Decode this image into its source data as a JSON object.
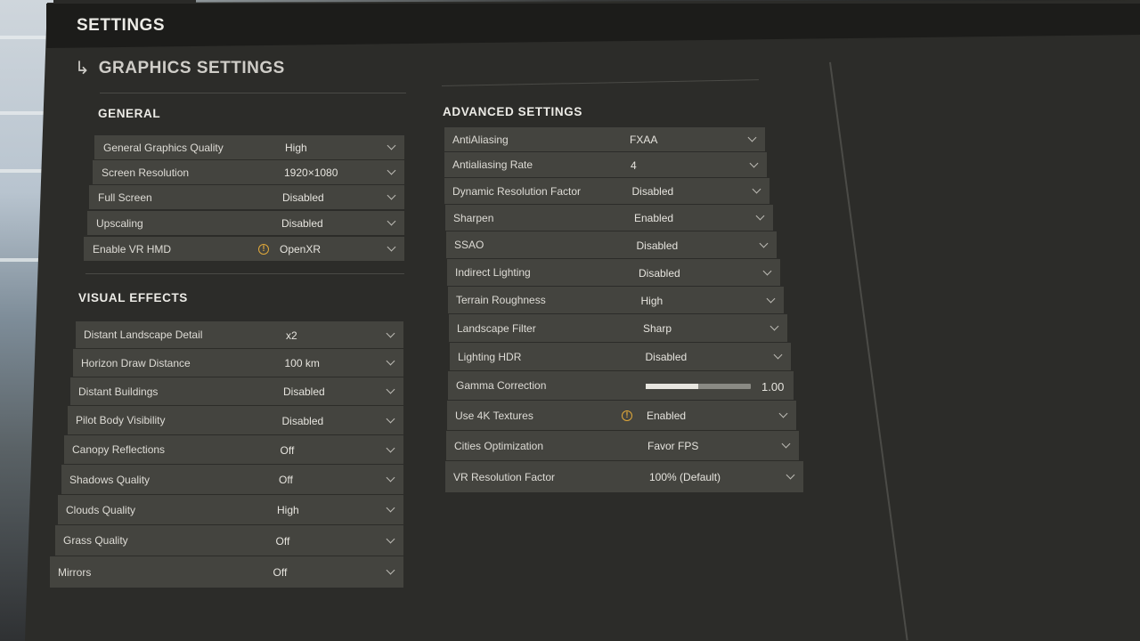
{
  "window": {
    "title": "SETTINGS"
  },
  "section": {
    "arrow": "↳",
    "title": "GRAPHICS SETTINGS"
  },
  "general": {
    "title": "GENERAL",
    "rows": [
      {
        "label": "General Graphics Quality",
        "value": "High"
      },
      {
        "label": "Screen Resolution",
        "value": "1920×1080"
      },
      {
        "label": "Full Screen",
        "value": "Disabled"
      },
      {
        "label": "Upscaling",
        "value": "Disabled"
      },
      {
        "label": "Enable VR HMD",
        "value": "OpenXR",
        "warning": true,
        "warn_glyph": "!"
      }
    ]
  },
  "visual_effects": {
    "title": "VISUAL EFFECTS",
    "rows": [
      {
        "label": "Distant Landscape Detail",
        "value": "x2"
      },
      {
        "label": "Horizon Draw Distance",
        "value": "100 km"
      },
      {
        "label": "Distant Buildings",
        "value": "Disabled"
      },
      {
        "label": "Pilot Body Visibility",
        "value": "Disabled"
      },
      {
        "label": "Canopy Reflections",
        "value": "Off"
      },
      {
        "label": "Shadows Quality",
        "value": "Off"
      },
      {
        "label": "Clouds Quality",
        "value": "High"
      },
      {
        "label": "Grass Quality",
        "value": "Off"
      },
      {
        "label": "Mirrors",
        "value": "Off"
      }
    ]
  },
  "advanced": {
    "title": "ADVANCED SETTINGS",
    "rows": [
      {
        "label": "AntiAliasing",
        "value": "FXAA"
      },
      {
        "label": "Antialiasing Rate",
        "value": "4"
      },
      {
        "label": "Dynamic Resolution Factor",
        "value": "Disabled"
      },
      {
        "label": "Sharpen",
        "value": "Enabled"
      },
      {
        "label": "SSAO",
        "value": "Disabled"
      },
      {
        "label": "Indirect Lighting",
        "value": "Disabled"
      },
      {
        "label": "Terrain Roughness",
        "value": "High"
      },
      {
        "label": "Landscape Filter",
        "value": "Sharp"
      },
      {
        "label": "Lighting HDR",
        "value": "Disabled"
      },
      {
        "label": "Gamma Correction",
        "value": "1.00",
        "slider": true,
        "slider_fraction": 0.5
      },
      {
        "label": "Use 4K Textures",
        "value": "Enabled",
        "warning": true,
        "warn_glyph": "!"
      },
      {
        "label": "Cities Optimization",
        "value": "Favor FPS"
      },
      {
        "label": "VR Resolution Factor",
        "value": "100% (Default)"
      }
    ]
  },
  "colors": {
    "accent_warning": "#e0a83a",
    "row_bg": "#44443f",
    "panel_bg": "#2c2c29"
  }
}
